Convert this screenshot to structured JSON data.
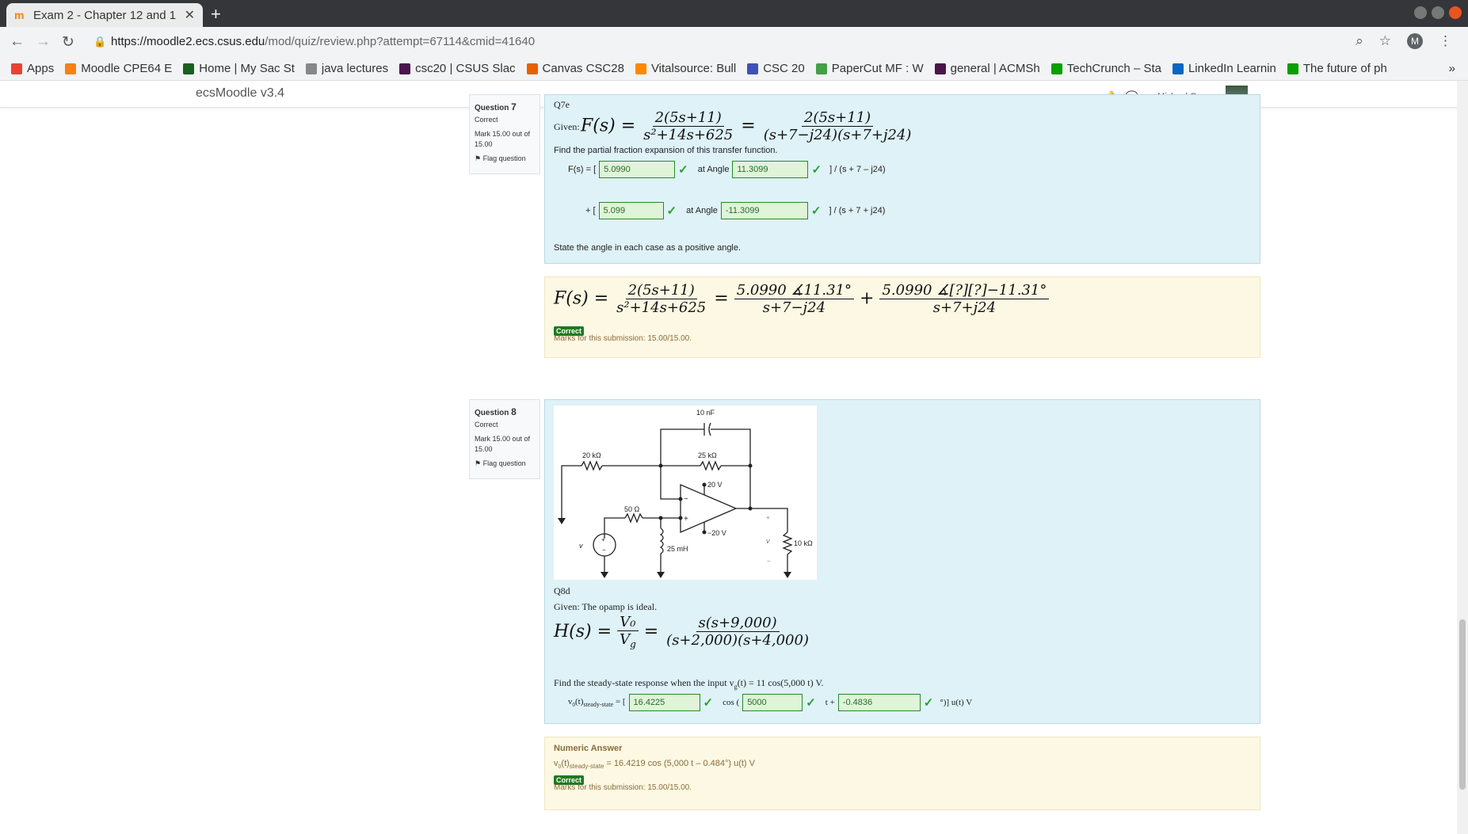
{
  "browser": {
    "tab_title": "Exam 2 - Chapter 12 and 1",
    "url_domain": "https://moodle2.ecs.csus.edu",
    "url_path": "/mod/quiz/review.php?attempt=67114&cmid=41640",
    "profile_initial": "M",
    "bookmarks": [
      {
        "label": "Apps",
        "color": "#e94235"
      },
      {
        "label": "Moodle CPE64 E",
        "color": "#f98012"
      },
      {
        "label": "Home | My Sac St",
        "color": "#1b5e20"
      },
      {
        "label": "java lectures",
        "color": "#888888"
      },
      {
        "label": "csc20 | CSUS Slac",
        "color": "#4a154b"
      },
      {
        "label": "Canvas CSC28",
        "color": "#e66000"
      },
      {
        "label": "Vitalsource: Bull",
        "color": "#ff8800"
      },
      {
        "label": "CSC 20",
        "color": "#3f51b5"
      },
      {
        "label": "PaperCut MF : W",
        "color": "#43a047"
      },
      {
        "label": "general | ACMSh",
        "color": "#4a154b"
      },
      {
        "label": "TechCrunch – Sta",
        "color": "#0a9e01"
      },
      {
        "label": "LinkedIn Learnin",
        "color": "#0a66c2"
      },
      {
        "label": "The future of ph",
        "color": "#0a9e01"
      }
    ],
    "overflow_label": "»"
  },
  "moodle": {
    "site_name": "ecsMoodle v3.4",
    "user_name": "Michael Gomez"
  },
  "q7": {
    "number_label": "Question",
    "number": "7",
    "status": "Correct",
    "mark": "Mark 15.00 out of 15.00",
    "flag": "Flag question",
    "title": "Q7e",
    "given_label": "Given:",
    "instruction": "Find the partial fraction expansion of this transfer function.",
    "fs_label": "F(s) = [",
    "row1_mag": "5.0990",
    "row1_angle": "11.3099",
    "row1_suffix": "] / (s + 7 – j24)",
    "plus_label": "+ [",
    "row2_mag": "5.099",
    "row2_angle": "-11.3099",
    "row2_suffix": "] / (s + 7 + j24)",
    "at_angle": "at Angle",
    "note": "State the angle in each case as a positive angle.",
    "feedback_badge": "Correct",
    "feedback_marks": "Marks for this submission: 15.00/15.00."
  },
  "q8": {
    "number_label": "Question",
    "number": "8",
    "status": "Correct",
    "mark": "Mark 15.00 out of 15.00",
    "flag": "Flag question",
    "title": "Q8d",
    "given": "Given: The opamp is ideal.",
    "instruction": "Find the steady-state response when the input v",
    "instruction_sub": "g",
    "instruction_tail": "(t) = 11 cos(5,000 t) V.",
    "answer_amp": "16.4225",
    "answer_freq": "5000",
    "answer_phase": "-0.4836",
    "cos_label": "cos (",
    "t_label": "t +",
    "tail_label": "°)] u(t) V",
    "numeric_title": "Numeric Answer",
    "numeric_text": "= 16.4219 cos (5,000 t – 0.484°) u(t) V",
    "feedback_badge": "Correct",
    "feedback_marks": "Marks for this submission: 15.00/15.00.",
    "circuit": {
      "c_label": "10 nF",
      "r1_label": "20 kΩ",
      "r2_label": "25 kΩ",
      "r3_label": "50 Ω",
      "l_label": "25 mH",
      "rl_label": "10 kΩ",
      "vpos": "20 V",
      "vneg": "−20 V",
      "vo": "v",
      "vg": "v"
    }
  }
}
